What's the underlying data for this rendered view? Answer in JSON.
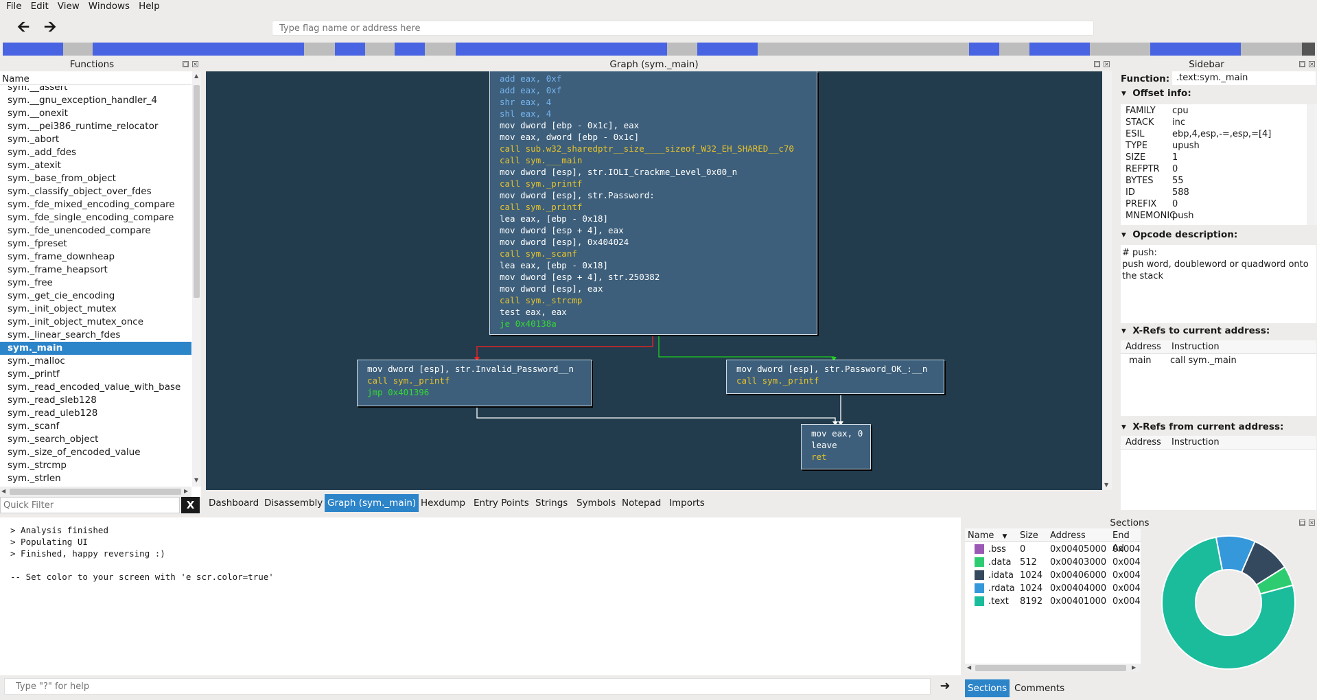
{
  "menubar": {
    "items": [
      "File",
      "Edit",
      "View",
      "Windows",
      "Help"
    ]
  },
  "toolbar": {
    "back_icon": "arrow-left-icon",
    "forward_icon": "arrow-right-icon",
    "flag_placeholder": "Type flag name or address here"
  },
  "segment_colors": {
    "mapped": "#4964e2",
    "unmapped": "#bdbdbd"
  },
  "functions": {
    "title": "Functions",
    "column": "Name",
    "items": [
      "sym.__assert",
      "sym.__gnu_exception_handler_4",
      "sym.__onexit",
      "sym.__pei386_runtime_relocator",
      "sym._abort",
      "sym._add_fdes",
      "sym._atexit",
      "sym._base_from_object",
      "sym._classify_object_over_fdes",
      "sym._fde_mixed_encoding_compare",
      "sym._fde_single_encoding_compare",
      "sym._fde_unencoded_compare",
      "sym._fpreset",
      "sym._frame_downheap",
      "sym._frame_heapsort",
      "sym._free",
      "sym._get_cie_encoding",
      "sym._init_object_mutex",
      "sym._init_object_mutex_once",
      "sym._linear_search_fdes",
      "sym._main",
      "sym._malloc",
      "sym._printf",
      "sym._read_encoded_value_with_base",
      "sym._read_sleb128",
      "sym._read_uleb128",
      "sym._scanf",
      "sym._search_object",
      "sym._size_of_encoded_value",
      "sym._strcmp",
      "sym._strlen"
    ],
    "selected": "sym._main",
    "filter_placeholder": "Quick Filter",
    "clear_label": "X"
  },
  "graph": {
    "title": "Graph (sym._main)",
    "main_block": [
      {
        "text": "add eax, 0xf",
        "color": "blue"
      },
      {
        "text": "add eax, 0xf",
        "color": "blue"
      },
      {
        "text": "shr eax, 4",
        "color": "blue"
      },
      {
        "text": "shl eax, 4",
        "color": "blue"
      },
      {
        "text": "mov dword [ebp - 0x1c], eax",
        "color": "white"
      },
      {
        "text": "mov eax, dword [ebp - 0x1c]",
        "color": "white"
      },
      {
        "text": "call sub.w32_sharedptr__size____sizeof_W32_EH_SHARED__c70",
        "color": "yellow"
      },
      {
        "text": "call sym.___main",
        "color": "yellow"
      },
      {
        "text": "mov dword [esp], str.IOLI_Crackme_Level_0x00_n",
        "color": "white"
      },
      {
        "text": "call sym._printf",
        "color": "yellow"
      },
      {
        "text": "mov dword [esp], str.Password:",
        "color": "white"
      },
      {
        "text": "call sym._printf",
        "color": "yellow"
      },
      {
        "text": "lea eax, [ebp - 0x18]",
        "color": "white"
      },
      {
        "text": "mov dword [esp + 4], eax",
        "color": "white"
      },
      {
        "text": "mov dword [esp], 0x404024",
        "color": "white"
      },
      {
        "text": "call sym._scanf",
        "color": "yellow"
      },
      {
        "text": "lea eax, [ebp - 0x18]",
        "color": "white"
      },
      {
        "text": "mov dword [esp + 4], str.250382",
        "color": "white"
      },
      {
        "text": "mov dword [esp], eax",
        "color": "white"
      },
      {
        "text": "call sym._strcmp",
        "color": "yellow"
      },
      {
        "text": "test eax, eax",
        "color": "white"
      },
      {
        "text": "je 0x40138a",
        "color": "green"
      }
    ],
    "left_block": [
      {
        "text": "mov dword [esp], str.Invalid_Password__n",
        "color": "white"
      },
      {
        "text": "call sym._printf",
        "color": "yellow"
      },
      {
        "text": "jmp 0x401396",
        "color": "green"
      }
    ],
    "right_block": [
      {
        "text": "mov dword [esp], str.Password_OK_:__n",
        "color": "white"
      },
      {
        "text": "call sym._printf",
        "color": "yellow"
      }
    ],
    "bottom_block": [
      {
        "text": "mov eax, 0",
        "color": "white"
      },
      {
        "text": "leave",
        "color": "white"
      },
      {
        "text": "ret",
        "color": "yellow"
      }
    ]
  },
  "tabs": [
    "Dashboard",
    "Disassembly",
    "Graph (sym._main)",
    "Hexdump",
    "Entry Points",
    "Strings",
    "Symbols",
    "Notepad",
    "Imports"
  ],
  "active_tab": "Graph (sym._main)",
  "sidebar": {
    "title": "Sidebar",
    "function_label": "Function:",
    "function_value": ".text:sym._main",
    "offset_info_label": "Offset info:",
    "offset_info": [
      {
        "k": "FAMILY",
        "v": "cpu"
      },
      {
        "k": "STACK",
        "v": "inc"
      },
      {
        "k": "ESIL",
        "v": "ebp,4,esp,-=,esp,=[4]"
      },
      {
        "k": "TYPE",
        "v": "upush"
      },
      {
        "k": "SIZE",
        "v": "1"
      },
      {
        "k": "REFPTR",
        "v": "0"
      },
      {
        "k": "BYTES",
        "v": "55"
      },
      {
        "k": "ID",
        "v": "588"
      },
      {
        "k": "PREFIX",
        "v": "0"
      },
      {
        "k": "MNEMONIC",
        "v": "push"
      }
    ],
    "opcode_label": "Opcode description:",
    "opcode_title": "# push:",
    "opcode_text": "push word, doubleword or quadword onto the stack",
    "xrefs_to_label": "X-Refs to current address:",
    "xrefs_from_label": "X-Refs from current address:",
    "col_address": "Address",
    "col_instruction": "Instruction",
    "xrefs_to": [
      {
        "address": "main",
        "instruction": "call sym._main"
      }
    ]
  },
  "console": {
    "lines": [
      "> Analysis finished",
      "> Populating UI",
      "> Finished, happy reversing :)",
      "",
      "-- Set color to your screen with 'e scr.color=true'"
    ],
    "input_placeholder": "Type \"?\" for help"
  },
  "sections": {
    "title": "Sections",
    "columns": [
      "Name",
      "Size",
      "Address",
      "End Ad"
    ],
    "rows": [
      {
        "name": ".bss",
        "size": "0",
        "address": "0x00405000",
        "end": "0x004",
        "color": "#9b59b6"
      },
      {
        "name": ".data",
        "size": "512",
        "address": "0x00403000",
        "end": "0x004",
        "color": "#2ecc71"
      },
      {
        "name": ".idata",
        "size": "1024",
        "address": "0x00406000",
        "end": "0x004",
        "color": "#34495e"
      },
      {
        "name": ".rdata",
        "size": "1024",
        "address": "0x00404000",
        "end": "0x004",
        "color": "#3498db"
      },
      {
        "name": ".text",
        "size": "8192",
        "address": "0x00401000",
        "end": "0x004",
        "color": "#1abc9c"
      }
    ],
    "bottom_tabs": [
      "Sections",
      "Comments"
    ],
    "active_bottom_tab": "Sections"
  },
  "donut": [
    {
      "name": ".text",
      "value": 8192,
      "color": "#1abc9c"
    },
    {
      "name": ".rdata",
      "value": 1024,
      "color": "#3498db"
    },
    {
      "name": ".idata",
      "value": 1024,
      "color": "#34495e"
    },
    {
      "name": ".data",
      "value": 512,
      "color": "#2ecc71"
    },
    {
      "name": ".bss",
      "value": 0,
      "color": "#9b59b6"
    }
  ]
}
